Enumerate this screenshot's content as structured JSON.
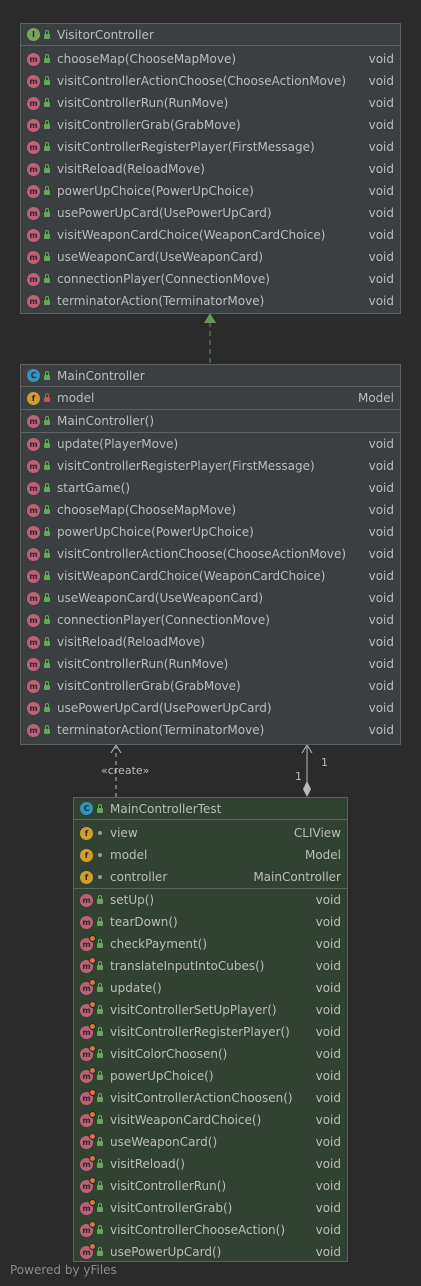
{
  "colors": {
    "background": "#2b2b2b",
    "class_fill": "#3c3f41",
    "test_class_fill": "#324232",
    "interface_badge": "#77a35c",
    "class_badge": "#3592c4",
    "method_badge": "#c15f76",
    "field_badge": "#d09c2d",
    "realization_edge": "#629755",
    "edge": "#bbbbbb"
  },
  "visitor_controller": {
    "name": "VisitorController",
    "kind": "interface",
    "methods": [
      {
        "name": "chooseMap(ChooseMapMove)",
        "type": "void"
      },
      {
        "name": "visitControllerActionChoose(ChooseActionMove)",
        "type": "void"
      },
      {
        "name": "visitControllerRun(RunMove)",
        "type": "void"
      },
      {
        "name": "visitControllerGrab(GrabMove)",
        "type": "void"
      },
      {
        "name": "visitControllerRegisterPlayer(FirstMessage)",
        "type": "void"
      },
      {
        "name": "visitReload(ReloadMove)",
        "type": "void"
      },
      {
        "name": "powerUpChoice(PowerUpChoice)",
        "type": "void"
      },
      {
        "name": "usePowerUpCard(UsePowerUpCard)",
        "type": "void"
      },
      {
        "name": "visitWeaponCardChoice(WeaponCardChoice)",
        "type": "void"
      },
      {
        "name": "useWeaponCard(UseWeaponCard)",
        "type": "void"
      },
      {
        "name": "connectionPlayer(ConnectionMove)",
        "type": "void"
      },
      {
        "name": "terminatorAction(TerminatorMove)",
        "type": "void"
      }
    ]
  },
  "main_controller": {
    "name": "MainController",
    "kind": "class",
    "fields": [
      {
        "name": "model",
        "type": "Model",
        "visibility": "private"
      }
    ],
    "constructors": [
      {
        "name": "MainController()",
        "type": ""
      }
    ],
    "methods": [
      {
        "name": "update(PlayerMove)",
        "type": "void"
      },
      {
        "name": "visitControllerRegisterPlayer(FirstMessage)",
        "type": "void"
      },
      {
        "name": "startGame()",
        "type": "void"
      },
      {
        "name": "chooseMap(ChooseMapMove)",
        "type": "void"
      },
      {
        "name": "powerUpChoice(PowerUpChoice)",
        "type": "void"
      },
      {
        "name": "visitControllerActionChoose(ChooseActionMove)",
        "type": "void"
      },
      {
        "name": "visitWeaponCardChoice(WeaponCardChoice)",
        "type": "void"
      },
      {
        "name": "useWeaponCard(UseWeaponCard)",
        "type": "void"
      },
      {
        "name": "connectionPlayer(ConnectionMove)",
        "type": "void"
      },
      {
        "name": "visitReload(ReloadMove)",
        "type": "void"
      },
      {
        "name": "visitControllerRun(RunMove)",
        "type": "void"
      },
      {
        "name": "visitControllerGrab(GrabMove)",
        "type": "void"
      },
      {
        "name": "usePowerUpCard(UsePowerUpCard)",
        "type": "void"
      },
      {
        "name": "terminatorAction(TerminatorMove)",
        "type": "void"
      }
    ]
  },
  "main_controller_test": {
    "name": "MainControllerTest",
    "kind": "class",
    "fields": [
      {
        "name": "view",
        "type": "CLIView"
      },
      {
        "name": "model",
        "type": "Model"
      },
      {
        "name": "controller",
        "type": "MainController"
      }
    ],
    "methods": [
      {
        "name": "setUp()",
        "type": "void",
        "override": false
      },
      {
        "name": "tearDown()",
        "type": "void",
        "override": false
      },
      {
        "name": "checkPayment()",
        "type": "void",
        "override": true
      },
      {
        "name": "translateInputIntoCubes()",
        "type": "void",
        "override": true
      },
      {
        "name": "update()",
        "type": "void",
        "override": true
      },
      {
        "name": "visitControllerSetUpPlayer()",
        "type": "void",
        "override": true
      },
      {
        "name": "visitControllerRegisterPlayer()",
        "type": "void",
        "override": true
      },
      {
        "name": "visitColorChoosen()",
        "type": "void",
        "override": true
      },
      {
        "name": "powerUpChoice()",
        "type": "void",
        "override": true
      },
      {
        "name": "visitControllerActionChoosen()",
        "type": "void",
        "override": true
      },
      {
        "name": "visitWeaponCardChoice()",
        "type": "void",
        "override": true
      },
      {
        "name": "useWeaponCard()",
        "type": "void",
        "override": true
      },
      {
        "name": "visitReload()",
        "type": "void",
        "override": true
      },
      {
        "name": "visitControllerRun()",
        "type": "void",
        "override": true
      },
      {
        "name": "visitControllerGrab()",
        "type": "void",
        "override": true
      },
      {
        "name": "visitControllerChooseAction()",
        "type": "void",
        "override": true
      },
      {
        "name": "usePowerUpCard()",
        "type": "void",
        "override": true
      }
    ]
  },
  "edges": {
    "create_label": "«create»",
    "multiplicity_source": "1",
    "multiplicity_target": "1"
  },
  "footer": "Powered by yFiles"
}
